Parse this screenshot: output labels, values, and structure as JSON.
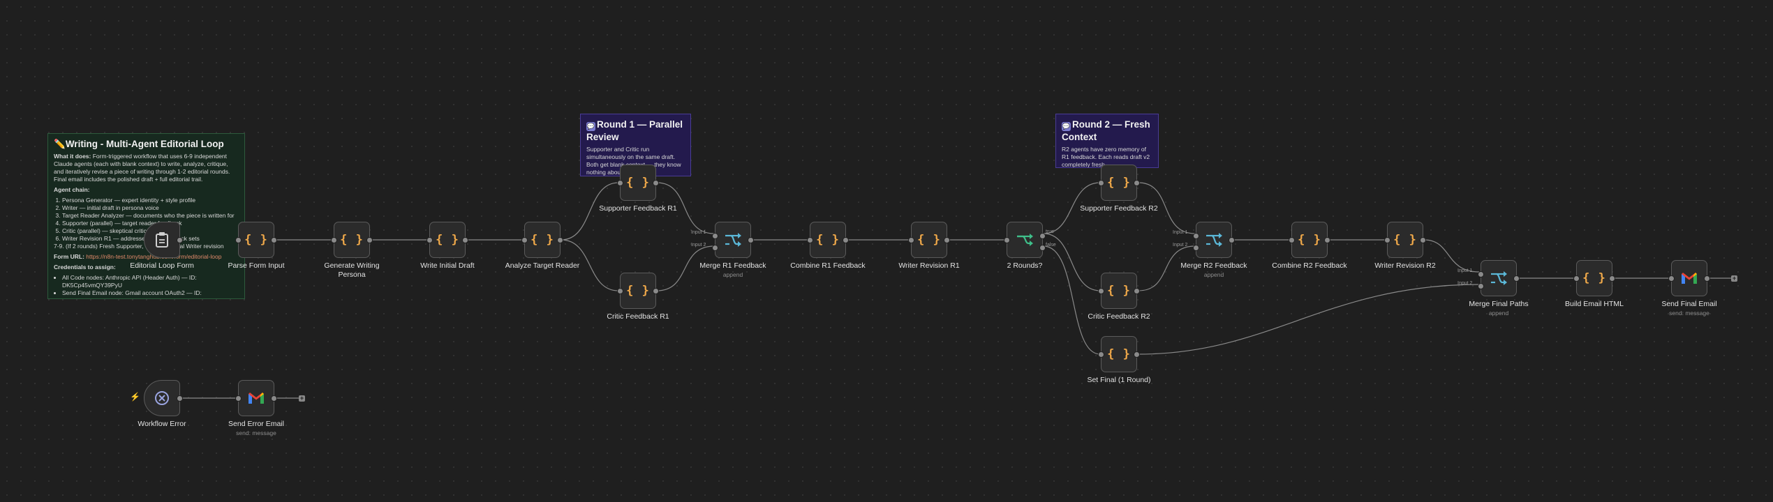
{
  "colors": {
    "canvas": "#1f1f1f",
    "node_fill": "#2b2b2b",
    "node_border": "#5b5b5b",
    "code_icon": "#f0a94a",
    "merge_icon": "#5bb8d8",
    "if_icon": "#3fbf8a",
    "edge": "#8a8a8a",
    "sticky_green": "#17291f",
    "sticky_purple": "#231a4d"
  },
  "notes": {
    "main": {
      "title": "Writing - Multi-Agent Editorial Loop",
      "what_label": "What it does:",
      "what_text": "Form-triggered workflow that uses 6-9 independent Claude agents (each with blank context) to write, analyze, critique, and iteratively revise a piece of writing through 1-2 editorial rounds. Final email includes the polished draft + full editorial trail.",
      "chain_label": "Agent chain:",
      "chain": [
        "Persona Generator — expert identity + style profile",
        "Writer — initial draft in persona voice",
        "Target Reader Analyzer — documents who the piece is written for",
        "Supporter (parallel) — target reader feedback",
        "Critic (parallel) — skeptical critic feedback",
        "Writer Revision R1 — addresses both feedback sets",
        "7-9. (If 2 rounds) Fresh Supporter, Critic, and final Writer revision"
      ],
      "form_label": "Form URL:",
      "form_url": "https://n8n-test.tonytanghub.com/form/editorial-loop",
      "creds_label": "Credentials to assign:",
      "creds": [
        "All Code nodes: Anthropic API (Header Auth) — ID: DK5Cp45vmQY39PyU",
        "Send Final Email node: Gmail account OAuth2 — ID:"
      ]
    },
    "round1": {
      "title": "Round 1 — Parallel Review",
      "text": "Supporter and Critic run simultaneously on the same draft. Both get blank context — they know nothing about"
    },
    "round2": {
      "title": "Round 2 — Fresh Context",
      "text": "R2 agents have zero memory of R1 feedback. Each reads draft v2 completely fresh."
    }
  },
  "nodes": {
    "form": {
      "label": "Editorial Loop Form",
      "icon": "clipboard-icon"
    },
    "parse": {
      "label": "Parse Form Input",
      "icon": "code-icon"
    },
    "persona": {
      "label": "Generate Writing Persona",
      "icon": "code-icon"
    },
    "draft": {
      "label": "Write Initial Draft",
      "icon": "code-icon"
    },
    "reader": {
      "label": "Analyze Target Reader",
      "icon": "code-icon"
    },
    "sup1": {
      "label": "Supporter Feedback R1",
      "icon": "code-icon"
    },
    "crit1": {
      "label": "Critic Feedback R1",
      "icon": "code-icon"
    },
    "merge1": {
      "label": "Merge R1 Feedback",
      "sub": "append",
      "icon": "merge-icon",
      "in1": "Input 1",
      "in2": "Input 2"
    },
    "comb1": {
      "label": "Combine R1 Feedback",
      "icon": "code-icon"
    },
    "rev1": {
      "label": "Writer Revision R1",
      "icon": "code-icon"
    },
    "if2": {
      "label": "2 Rounds?",
      "icon": "if-icon",
      "t": "true",
      "f": "false"
    },
    "sup2": {
      "label": "Supporter Feedback R2",
      "icon": "code-icon"
    },
    "crit2": {
      "label": "Critic Feedback R2",
      "icon": "code-icon"
    },
    "setfinal": {
      "label": "Set Final (1 Round)",
      "icon": "code-icon"
    },
    "merge2": {
      "label": "Merge R2 Feedback",
      "sub": "append",
      "icon": "merge-icon",
      "in1": "Input 1",
      "in2": "Input 2"
    },
    "comb2": {
      "label": "Combine R2 Feedback",
      "icon": "code-icon"
    },
    "rev2": {
      "label": "Writer Revision R2",
      "icon": "code-icon"
    },
    "mergef": {
      "label": "Merge Final Paths",
      "sub": "append",
      "icon": "merge-icon",
      "in1": "Input 1",
      "in2": "Input 2"
    },
    "html": {
      "label": "Build Email HTML",
      "icon": "code-icon"
    },
    "send": {
      "label": "Send Final Email",
      "sub": "send: message",
      "icon": "gmail-icon"
    },
    "werr": {
      "label": "Workflow Error",
      "icon": "error-trigger-icon"
    },
    "senderr": {
      "label": "Send Error Email",
      "sub": "send: message",
      "icon": "gmail-icon"
    }
  },
  "code_glyph": "{ }",
  "plus_glyph": "+"
}
